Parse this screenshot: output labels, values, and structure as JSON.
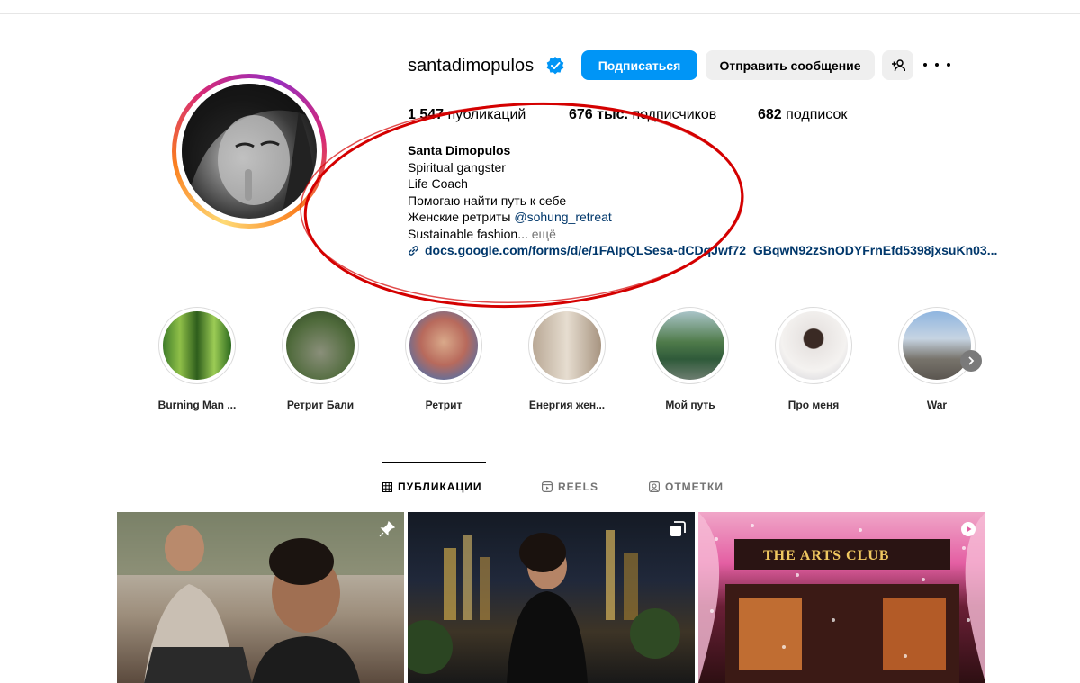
{
  "profile": {
    "username": "santadimopulos",
    "verified": true,
    "follow_label": "Подписаться",
    "message_label": "Отправить сообщение",
    "posts_count": "1 547",
    "posts_label": "публикаций",
    "followers_count": "676 тыс.",
    "followers_label": "подписчиков",
    "following_count": "682",
    "following_label": "подписок"
  },
  "bio": {
    "name": "Santa Dimopulos",
    "line1": "Spiritual gangster",
    "line2": "Life Coach",
    "line3": "Помогаю найти путь к себе",
    "line4_prefix": "Женские ретриты ",
    "line4_mention": "@sohung_retreat",
    "line5": "Sustainable fashion...",
    "more": "ещё",
    "link": "docs.google.com/forms/d/e/1FAIpQLSesa-dCDqJwf72_GBqwN92zSnODYFrnEfd5398jxsuKn03..."
  },
  "highlights": [
    {
      "label": "Burning Man ..."
    },
    {
      "label": "Ретрит Бали"
    },
    {
      "label": "Ретрит"
    },
    {
      "label": "Енергия жен..."
    },
    {
      "label": "Мой путь"
    },
    {
      "label": "Про меня"
    },
    {
      "label": "War"
    }
  ],
  "tabs": {
    "posts": "ПУБЛИКАЦИИ",
    "reels": "REELS",
    "tagged": "ОТМЕТКИ"
  },
  "posts": [
    {
      "badge": "pin-icon"
    },
    {
      "badge": "carousel-icon"
    },
    {
      "badge": "reels-icon",
      "text": "THE ARTS CLUB"
    }
  ],
  "colors": {
    "accent": "#0095f6",
    "link": "#00376b",
    "annotation": "#d40000"
  }
}
